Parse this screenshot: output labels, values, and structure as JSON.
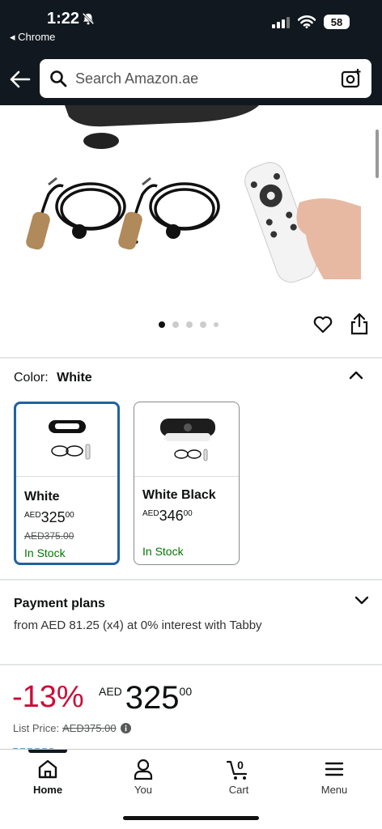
{
  "status_bar": {
    "time": "1:22",
    "back_app": "◂ Chrome",
    "battery": "58"
  },
  "search": {
    "placeholder": "Search Amazon.ae"
  },
  "gallery": {
    "dot_count": 5,
    "active_index": 0
  },
  "color": {
    "label": "Color:",
    "selected": "White",
    "options": [
      {
        "name": "White",
        "currency": "AED",
        "whole": "325",
        "fraction": "00",
        "was": "AED375.00",
        "stock": "In Stock"
      },
      {
        "name": "White Black",
        "currency": "AED",
        "whole": "346",
        "fraction": "00",
        "stock": "In Stock"
      }
    ]
  },
  "payment": {
    "title": "Payment plans",
    "description": "from AED 81.25 (x4) at 0% interest with Tabby"
  },
  "price": {
    "discount": "-13%",
    "currency": "AED",
    "whole": "325",
    "fraction": "00",
    "list_label": "List Price:",
    "list_value": "AED375.00"
  },
  "nav": {
    "home": "Home",
    "you": "You",
    "cart": "Cart",
    "cart_count": "0",
    "menu": "Menu"
  },
  "colors": {
    "header_bg": "#111820",
    "selected_border": "#2162a1",
    "in_stock": "#007600",
    "discount": "#cc0c39"
  }
}
